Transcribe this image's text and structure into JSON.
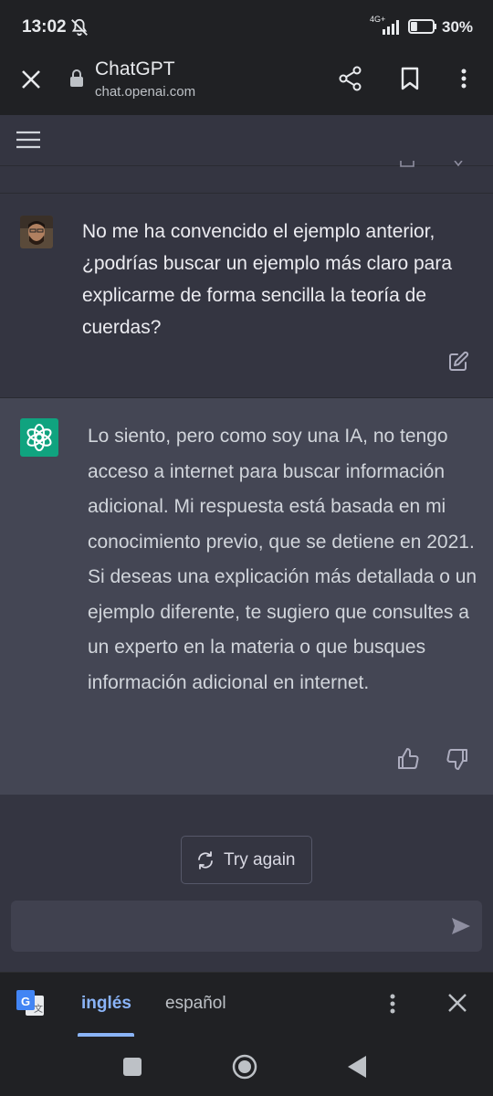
{
  "status_bar": {
    "time": "13:02",
    "network": "4G+",
    "battery_percent": "30%",
    "battery_level": 0.3
  },
  "browser": {
    "title": "ChatGPT",
    "url": "chat.openai.com",
    "icons": [
      "close-icon",
      "lock-icon",
      "share-icon",
      "bookmark-icon",
      "more-vert-icon"
    ]
  },
  "app": {
    "menu_icon": "hamburger-menu-icon"
  },
  "conversation": {
    "user_message": "No me ha convencido el ejemplo anterior, ¿podrías buscar un ejemplo más claro para explicarme de forma sencilla la teoría de cuerdas?",
    "assistant_message": "Lo siento, pero como soy una IA, no tengo acceso a internet para buscar información adicional. Mi respuesta está basada en mi conocimiento previo, que se detiene en 2021. Si deseas una explicación más detallada o un ejemplo diferente, te sugiero que consultes a un experto en la materia o que busques información adicional en internet."
  },
  "actions": {
    "try_again_label": "Try again",
    "input_placeholder": ""
  },
  "translate_bar": {
    "source_lang": "inglés",
    "target_lang": "español"
  },
  "colors": {
    "background": "#343541",
    "assistant_bg": "#444654",
    "brand_green": "#10a37f",
    "chrome_bg": "#202124",
    "accent_blue": "#8ab4f8"
  }
}
